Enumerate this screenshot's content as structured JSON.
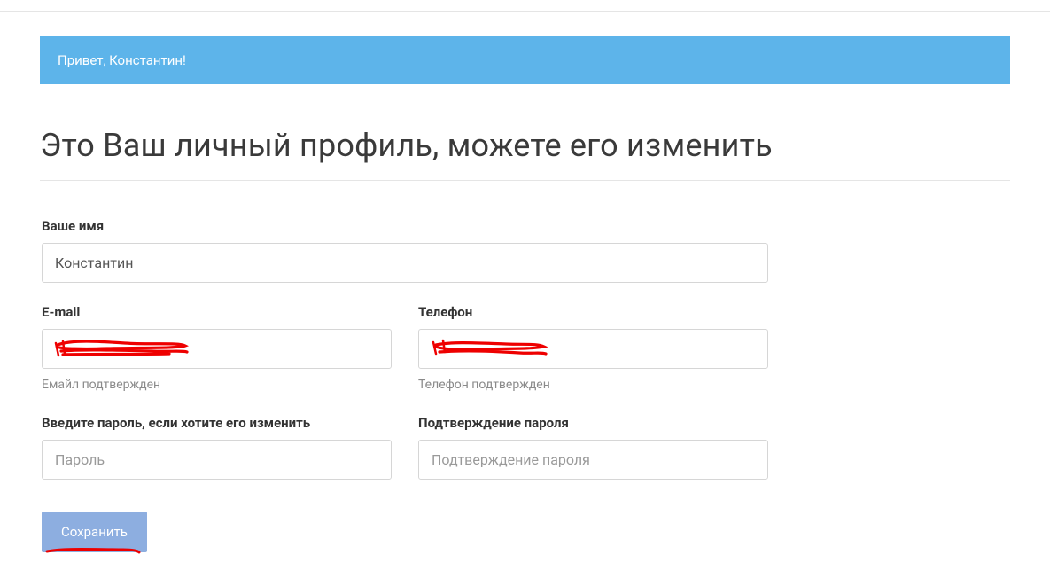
{
  "banner": {
    "greeting": "Привет, Константин!"
  },
  "page": {
    "title": "Это Ваш личный профиль, можете его изменить"
  },
  "form": {
    "name": {
      "label": "Ваше имя",
      "value": "Константин"
    },
    "email": {
      "label": "E-mail",
      "value": "",
      "helper": "Емайл подтвержден"
    },
    "phone": {
      "label": "Телефон",
      "value": "",
      "helper": "Телефон подтвержден"
    },
    "password": {
      "label": "Введите пароль, если хотите его изменить",
      "placeholder": "Пароль"
    },
    "password_confirm": {
      "label": "Подтверждение пароля",
      "placeholder": "Подтверждение пароля"
    },
    "save_label": "Сохранить"
  },
  "annotations": {
    "redacted_color": "#ee0000"
  }
}
